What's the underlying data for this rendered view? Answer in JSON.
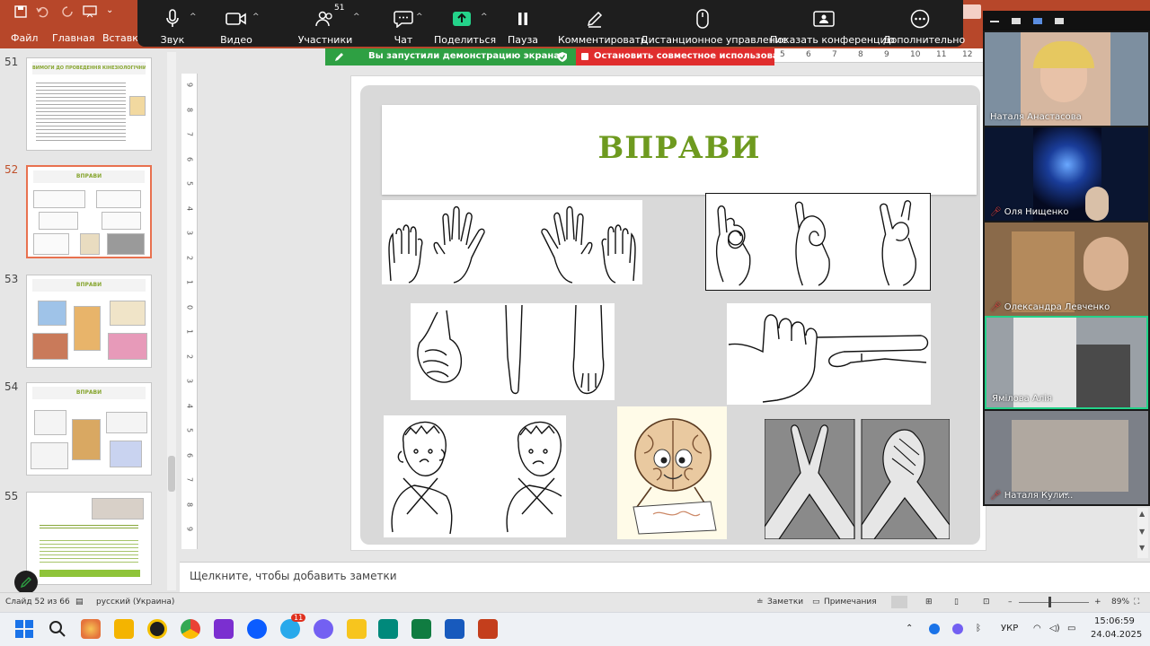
{
  "powerpoint": {
    "ribbon_tabs": [
      "Файл",
      "Главная",
      "Вставка"
    ],
    "quick_access": {
      "save_icon": "save-icon",
      "undo_icon": "undo-icon",
      "redo_icon": "redo-icon"
    }
  },
  "zoom_toolbar": {
    "items": [
      {
        "label": "Звук",
        "icon": "microphone-icon"
      },
      {
        "label": "Видео",
        "icon": "video-camera-icon"
      },
      {
        "label": "Участники",
        "icon": "participants-icon",
        "count": "51"
      },
      {
        "label": "Чат",
        "icon": "chat-icon"
      },
      {
        "label": "Поделиться",
        "icon": "share-screen-icon"
      },
      {
        "label": "Пауза",
        "icon": "pause-icon"
      },
      {
        "label": "Комментировать",
        "icon": "annotate-pen-icon"
      },
      {
        "label": "Дистанционное управление",
        "icon": "remote-control-mouse-icon"
      },
      {
        "label": "Показать конференцию",
        "icon": "show-meeting-icon"
      },
      {
        "label": "Дополнительно",
        "icon": "more-icon"
      }
    ],
    "share_banner": "Вы запустили демонстрацию экрана",
    "stop_share": "Остановить совместное использование",
    "accent_green": "#2ea043",
    "accent_red": "#e02d2d"
  },
  "thumbnails": [
    {
      "num": "51",
      "title": "ВИМОГИ ДО ПРОВЕДЕННЯ КІНЕЗІОЛОГІЧНИХ ВПРАВ"
    },
    {
      "num": "52",
      "title": "ВПРАВИ",
      "selected": true
    },
    {
      "num": "53",
      "title": "ВПРАВИ"
    },
    {
      "num": "54",
      "title": "ВПРАВИ"
    },
    {
      "num": "55",
      "title": ""
    }
  ],
  "ruler": {
    "top_marks": [
      "5",
      "6",
      "7",
      "8",
      "9",
      "10",
      "11",
      "12"
    ],
    "left_marks": [
      "9",
      "8",
      "7",
      "6",
      "5",
      "4",
      "3",
      "2",
      "1",
      "0",
      "1",
      "2",
      "3",
      "4",
      "5",
      "6",
      "7",
      "8",
      "9"
    ]
  },
  "slide": {
    "title": "ВПРАВИ",
    "title_color": "#6e9a1f",
    "images": [
      "hands-spread-fingers-image",
      "finger-ring-gesture-image",
      "fist-edge-palm-image",
      "hand-pointing-image",
      "boy-ear-nose-image",
      "brain-character-image",
      "crossed-arms-image"
    ]
  },
  "notes": {
    "placeholder": "Щелкните, чтобы добавить заметки"
  },
  "status": {
    "slide_info": "Слайд 52 из 66",
    "language": "русский (Украина)",
    "notes_label": "Заметки",
    "comments_label": "Примечания",
    "zoom": "89%"
  },
  "gallery": {
    "participants": [
      {
        "name": "Наталя Анастасова",
        "muted": false
      },
      {
        "name": "Оля Нищенко",
        "muted": true
      },
      {
        "name": "Олександра Левченко",
        "muted": true
      },
      {
        "name": "Ямілова Алія",
        "muted": false,
        "active": true
      },
      {
        "name": "Наталя Кули...",
        "muted": true
      }
    ]
  },
  "taskbar": {
    "apps": [
      "start-icon",
      "search-icon",
      "paint-icon",
      "file-explorer-icon",
      "kinemaster-icon",
      "chrome-icon",
      "media-player-icon",
      "zoom-icon",
      "telegram-icon",
      "viber-icon",
      "pdf-icon",
      "meet-icon",
      "excel-icon",
      "word-icon",
      "powerpoint-icon"
    ],
    "telegram_badge": "11",
    "language": "УКР",
    "time": "15:06:59",
    "date": "24.04.2025"
  }
}
